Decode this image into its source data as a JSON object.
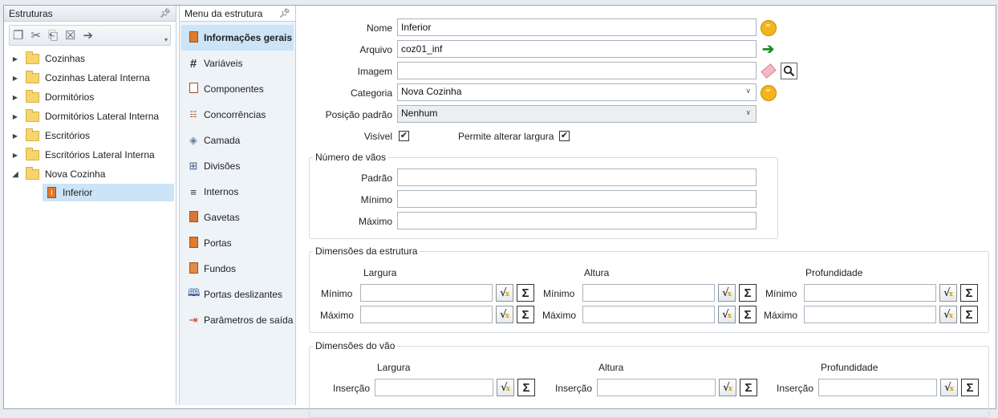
{
  "left_panel": {
    "title": "Estruturas",
    "pin": "P",
    "toolbar_icons": [
      "copy-icon",
      "cut-icon",
      "paste-icon",
      "delete-icon",
      "move-icon"
    ],
    "tree": [
      {
        "label": "Cozinhas",
        "expanded": false
      },
      {
        "label": "Cozinhas Lateral Interna",
        "expanded": false
      },
      {
        "label": "Dormitórios",
        "expanded": false
      },
      {
        "label": "Dormitórios Lateral Interna",
        "expanded": false
      },
      {
        "label": "Escritórios",
        "expanded": false
      },
      {
        "label": "Escritórios Lateral Interna",
        "expanded": false
      },
      {
        "label": "Nova Cozinha",
        "expanded": true
      }
    ],
    "selected_child": "Inferior"
  },
  "menu_panel": {
    "title": "Menu da estrutura",
    "items": [
      {
        "label": "Informações gerais",
        "icon": "cabinet-icon",
        "active": true
      },
      {
        "label": "Variáveis",
        "icon": "hash-icon"
      },
      {
        "label": "Componentes",
        "icon": "component-icon"
      },
      {
        "label": "Concorrências",
        "icon": "concurrency-icon"
      },
      {
        "label": "Camada",
        "icon": "layer-icon"
      },
      {
        "label": "Divisões",
        "icon": "grid-icon"
      },
      {
        "label": "Internos",
        "icon": "internal-icon"
      },
      {
        "label": "Gavetas",
        "icon": "drawer-icon"
      },
      {
        "label": "Portas",
        "icon": "door-icon"
      },
      {
        "label": "Fundos",
        "icon": "back-panel-icon"
      },
      {
        "label": "Portas deslizantes",
        "icon": "sliding-door-icon"
      },
      {
        "label": "Parâmetros de saída",
        "icon": "output-icon"
      }
    ]
  },
  "form": {
    "nome_label": "Nome",
    "nome_value": "Inferior",
    "arquivo_label": "Arquivo",
    "arquivo_value": "coz01_inf",
    "imagem_label": "Imagem",
    "imagem_value": "",
    "categoria_label": "Categoria",
    "categoria_value": "Nova Cozinha",
    "posicao_label": "Posição padrão",
    "posicao_value": "Nenhum",
    "visivel_label": "Visível",
    "visivel_checked": "✔",
    "permite_label": "Permite alterar largura",
    "permite_checked": "✔",
    "quote_glyph": "”"
  },
  "vaos": {
    "title": "Número de vãos",
    "padrao_label": "Padrão",
    "minimo_label": "Mínimo",
    "maximo_label": "Máximo"
  },
  "dim_estrutura": {
    "title": "Dimensões da estrutura",
    "largura": "Largura",
    "altura": "Altura",
    "profundidade": "Profundidade",
    "minimo": "Mínimo",
    "maximo": "Máximo"
  },
  "dim_vao": {
    "title": "Dimensões do vão",
    "largura": "Largura",
    "altura": "Altura",
    "profundidade": "Profundidade",
    "insercao": "Inserção"
  },
  "symbols": {
    "sqrt": "√",
    "sqrt_x": "x",
    "sigma": "Σ"
  }
}
